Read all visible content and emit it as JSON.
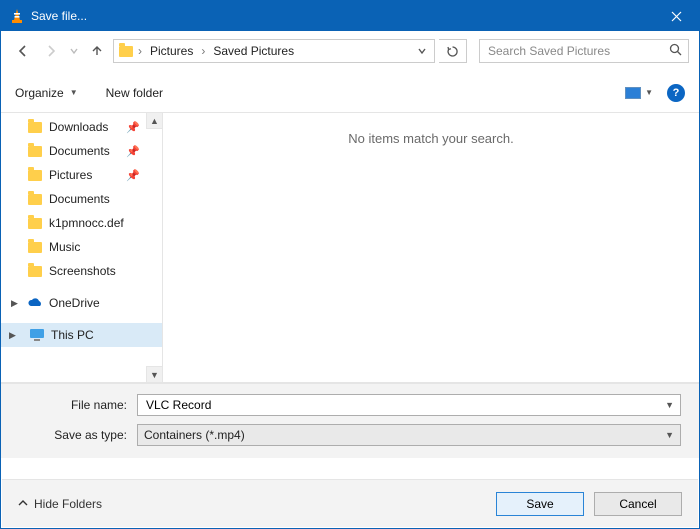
{
  "window": {
    "title": "Save file..."
  },
  "nav": {
    "crumbs": [
      "Pictures",
      "Saved Pictures"
    ]
  },
  "search": {
    "placeholder": "Search Saved Pictures"
  },
  "toolbar": {
    "organize": "Organize",
    "new_folder": "New folder"
  },
  "sidebar": {
    "items": [
      {
        "label": "Downloads",
        "pinned": true
      },
      {
        "label": "Documents",
        "pinned": true
      },
      {
        "label": "Pictures",
        "pinned": true
      },
      {
        "label": "Documents"
      },
      {
        "label": "k1pmnocc.def"
      },
      {
        "label": "Music"
      },
      {
        "label": "Screenshots"
      }
    ],
    "onedrive": "OneDrive",
    "thispc": "This PC"
  },
  "content": {
    "empty_message": "No items match your search."
  },
  "form": {
    "filename_label": "File name:",
    "filename_value": "VLC Record",
    "type_label": "Save as type:",
    "type_value": "Containers (*.mp4)"
  },
  "footer": {
    "hide_folders": "Hide Folders",
    "save": "Save",
    "cancel": "Cancel"
  }
}
